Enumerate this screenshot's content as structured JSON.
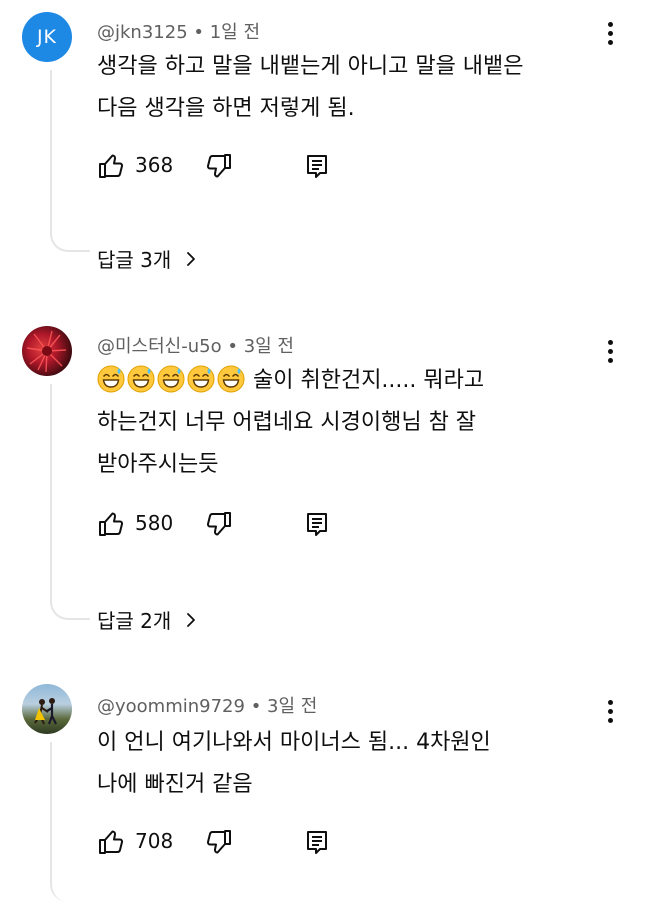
{
  "comments": [
    {
      "author": "@jkn3125",
      "time": "1일 전",
      "avatar_initials": "JK",
      "lines": [
        "생각을 하고 말을 내뱉는게 아니고 말을 내뱉은",
        "다음 생각을 하면 저렇게 됨."
      ],
      "likes": "368",
      "replies": "답글 3개"
    },
    {
      "author": "@미스터신-u5o",
      "time": "3일 전",
      "emoji_count": 5,
      "lines": [
        "술이 취한건지..... 뭐라고",
        "하는건지 너무 어렵네요 시경이행님 참 잘",
        "받아주시는듯"
      ],
      "likes": "580",
      "replies": "답글 2개"
    },
    {
      "author": "@yoommin9729",
      "time": "3일 전",
      "lines": [
        "이 언니 여기나와서 마이너스 됨... 4차원인",
        "나에 빠진거 같음"
      ],
      "likes": "708"
    }
  ],
  "icons": {
    "like": "thumbs-up-icon",
    "dislike": "thumbs-down-icon",
    "reply": "reply-comment-icon",
    "more": "more-vertical-icon",
    "chevron": "chevron-right-icon",
    "emoji": "grinning-sweat-emoji"
  },
  "colors": {
    "avatar_jk": "#1e88e5",
    "meta": "#606060",
    "thread_line": "#e5e5e5"
  }
}
